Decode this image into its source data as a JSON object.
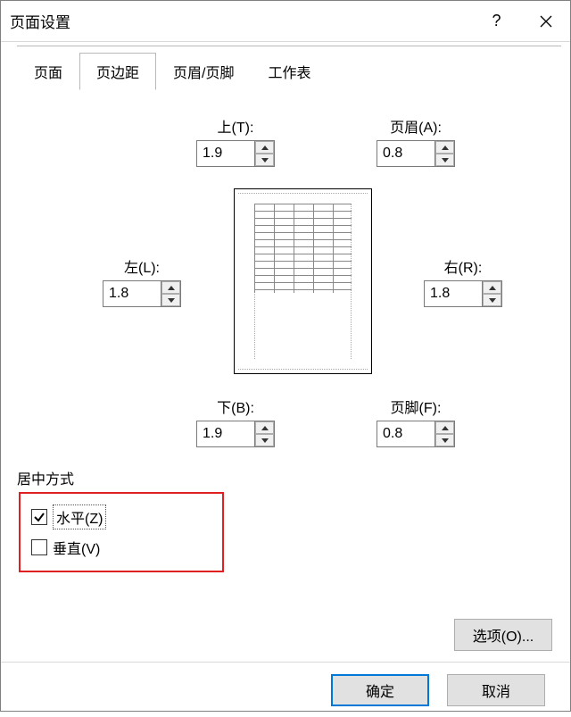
{
  "window": {
    "title": "页面设置"
  },
  "tabs": {
    "page": "页面",
    "margins": "页边距",
    "headerfooter": "页眉/页脚",
    "sheet": "工作表"
  },
  "margins": {
    "top_label": "上(T):",
    "top": "1.9",
    "header_label": "页眉(A):",
    "header": "0.8",
    "left_label": "左(L):",
    "left": "1.8",
    "right_label": "右(R):",
    "right": "1.8",
    "bottom_label": "下(B):",
    "bottom": "1.9",
    "footer_label": "页脚(F):",
    "footer": "0.8"
  },
  "center": {
    "legend": "居中方式",
    "horizontal": "水平(Z)",
    "horizontal_checked": true,
    "vertical": "垂直(V)",
    "vertical_checked": false
  },
  "buttons": {
    "options": "选项(O)...",
    "ok": "确定",
    "cancel": "取消"
  }
}
